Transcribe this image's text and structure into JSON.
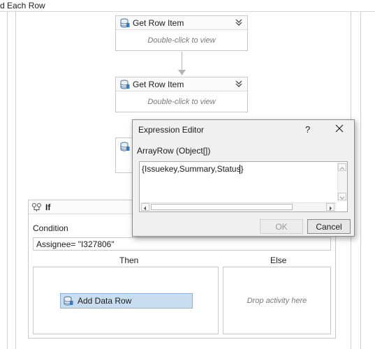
{
  "window": {
    "title": "d Each Row"
  },
  "activities": [
    {
      "title": "Get Row Item",
      "hint": "Double-click to view"
    },
    {
      "title": "Get Row Item",
      "hint": "Double-click to view"
    }
  ],
  "if_activity": {
    "title": "If",
    "condition_label": "Condition",
    "condition_value": "Assignee= \"I327806\"",
    "then_label": "Then",
    "else_label": "Else",
    "then_activity": "Add Data Row",
    "else_placeholder": "Drop activity here"
  },
  "dialog": {
    "title": "Expression Editor",
    "help": "?",
    "variable": "ArrayRow (Object[])",
    "expression": "{Issuekey,Summary,Status}",
    "ok_label": "OK",
    "cancel_label": "Cancel",
    "ok_enabled": false
  },
  "icons": {
    "activity": "database-icon",
    "if": "if-branch-icon",
    "collapse": "chevron-double-down-icon",
    "close": "close-icon"
  },
  "colors": {
    "selected_activity": "#c9ddf0",
    "selected_border": "#8fb4dc",
    "border": "#c9c9c9"
  }
}
